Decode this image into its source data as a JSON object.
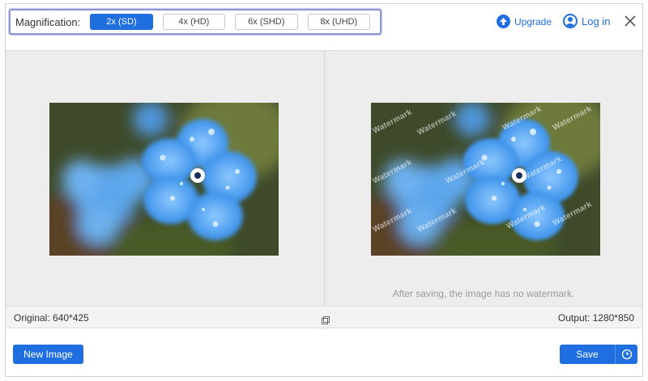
{
  "header": {
    "magnification_label": "Magnification:",
    "options": [
      {
        "label": "2x (SD)",
        "active": true
      },
      {
        "label": "4x (HD)",
        "active": false
      },
      {
        "label": "6x (SHD)",
        "active": false
      },
      {
        "label": "8x (UHD)",
        "active": false
      }
    ],
    "upgrade_label": "Upgrade",
    "login_label": "Log in"
  },
  "preview": {
    "watermark_text": "Watermark",
    "note": "After saving, the image has no watermark."
  },
  "info": {
    "original": "Original: 640*425",
    "output": "Output: 1280*850"
  },
  "footer": {
    "new_image_label": "New Image",
    "save_label": "Save"
  },
  "colors": {
    "accent": "#1f6fe0",
    "highlight_border": "#8e96d6",
    "preview_bg": "#ededed"
  },
  "icons": [
    "upload-arrow-icon",
    "user-icon",
    "close-icon",
    "compare-icon",
    "clock-icon"
  ]
}
